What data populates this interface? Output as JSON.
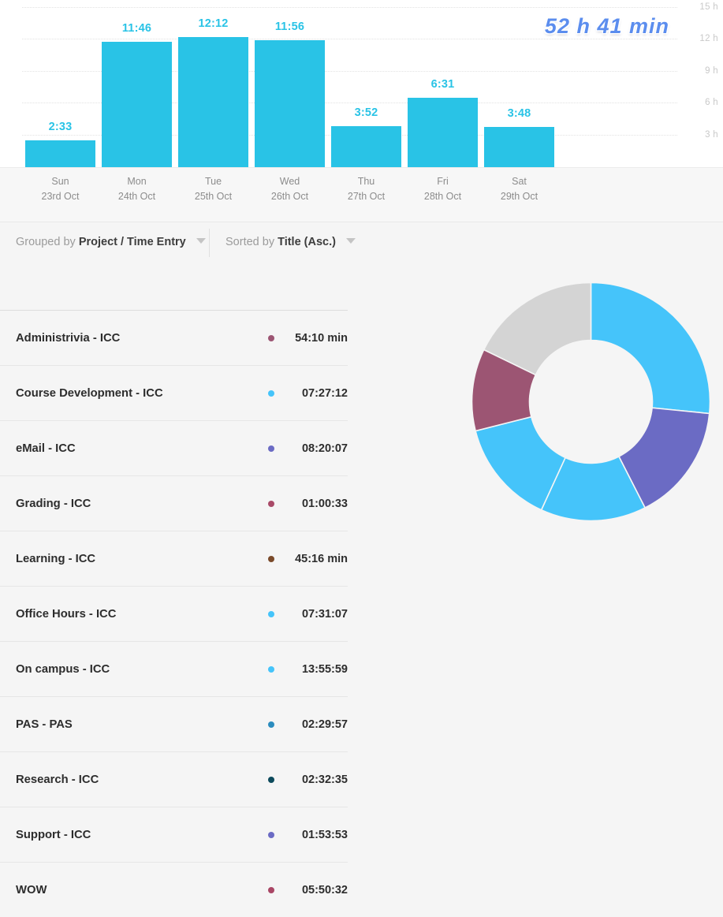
{
  "chart_data": [
    {
      "type": "bar",
      "title": "",
      "xlabel": "",
      "ylabel": "hours",
      "ylim": [
        0,
        15
      ],
      "grid": true,
      "yticks": [
        "3 h",
        "6 h",
        "9 h",
        "12 h",
        "15 h"
      ],
      "ytick_values": [
        3,
        6,
        9,
        12,
        15
      ],
      "categories": [
        "Sun",
        "Mon",
        "Tue",
        "Wed",
        "Thu",
        "Fri",
        "Sat"
      ],
      "dates": [
        "23rd Oct",
        "24th Oct",
        "25th Oct",
        "26th Oct",
        "27th Oct",
        "28th Oct",
        "29th Oct"
      ],
      "labels": [
        "2:33",
        "11:46",
        "12:12",
        "11:56",
        "3:52",
        "6:31",
        "3:48"
      ],
      "values": [
        2.55,
        11.77,
        12.2,
        11.93,
        3.87,
        6.52,
        3.8
      ],
      "total": "52 h 41 min",
      "bar_color": "#29c3e6",
      "label_color": "#29c3e6",
      "total_color": "#5b8dee"
    },
    {
      "type": "pie",
      "title": "",
      "donut": true,
      "legend": "none",
      "labels": [
        "On campus - ICC",
        "eMail - ICC",
        "Office Hours - ICC",
        "Course Development - ICC",
        "WOW",
        "Administrivia - ICC"
      ],
      "values": [
        13.93,
        8.34,
        7.52,
        7.45,
        5.84,
        9.33
      ],
      "colors": [
        "#45c4fa",
        "#6b6bc4",
        "#45c4fa",
        "#45c4fa",
        "#9c5573",
        "#d4d4d4"
      ],
      "start_angle": 0
    }
  ],
  "chart": {
    "total_label": "52 h 41 min",
    "y_ticks": [
      {
        "label": "15 h",
        "value": 15
      },
      {
        "label": "12 h",
        "value": 12
      },
      {
        "label": "9 h",
        "value": 9
      },
      {
        "label": "6 h",
        "value": 6
      },
      {
        "label": "3 h",
        "value": 3
      }
    ],
    "bars": [
      {
        "dow": "Sun",
        "date": "23rd Oct",
        "label": "2:33",
        "value": 2.55
      },
      {
        "dow": "Mon",
        "date": "24th Oct",
        "label": "11:46",
        "value": 11.77
      },
      {
        "dow": "Tue",
        "date": "25th Oct",
        "label": "12:12",
        "value": 12.2
      },
      {
        "dow": "Wed",
        "date": "26th Oct",
        "label": "11:56",
        "value": 11.93
      },
      {
        "dow": "Thu",
        "date": "27th Oct",
        "label": "3:52",
        "value": 3.87
      },
      {
        "dow": "Fri",
        "date": "28th Oct",
        "label": "6:31",
        "value": 6.52
      },
      {
        "dow": "Sat",
        "date": "29th Oct",
        "label": "3:48",
        "value": 3.8
      }
    ]
  },
  "controls": {
    "grouped_by_prefix": "Grouped by",
    "grouped_by_value": "Project / Time Entry",
    "sorted_by_prefix": "Sorted by",
    "sorted_by_value": "Title (Asc.)"
  },
  "entries": [
    {
      "title": "Administrivia - ICC",
      "duration": "54:10 min",
      "color": "#9c5573"
    },
    {
      "title": "Course Development - ICC",
      "duration": "07:27:12",
      "color": "#45c4fa"
    },
    {
      "title": "eMail - ICC",
      "duration": "08:20:07",
      "color": "#6b6bc4"
    },
    {
      "title": "Grading - ICC",
      "duration": "01:00:33",
      "color": "#a94a68"
    },
    {
      "title": "Learning - ICC",
      "duration": "45:16 min",
      "color": "#7a4a2a"
    },
    {
      "title": "Office Hours - ICC",
      "duration": "07:31:07",
      "color": "#45c4fa"
    },
    {
      "title": "On campus - ICC",
      "duration": "13:55:59",
      "color": "#45c4fa"
    },
    {
      "title": "PAS - PAS",
      "duration": "02:29:57",
      "color": "#2b8cbe"
    },
    {
      "title": "Research - ICC",
      "duration": "02:32:35",
      "color": "#0d4a5c"
    },
    {
      "title": "Support - ICC",
      "duration": "01:53:53",
      "color": "#6b6bc4"
    },
    {
      "title": "WOW",
      "duration": "05:50:32",
      "color": "#a94665"
    }
  ],
  "donut": {
    "segments": [
      {
        "name": "On campus - ICC",
        "value": 13.93,
        "color": "#45c4fa"
      },
      {
        "name": "eMail - ICC",
        "value": 8.34,
        "color": "#6b6bc4"
      },
      {
        "name": "Office Hours - ICC",
        "value": 7.52,
        "color": "#45c4fa"
      },
      {
        "name": "Course Development - ICC",
        "value": 7.45,
        "color": "#45c4fa"
      },
      {
        "name": "WOW",
        "value": 5.84,
        "color": "#9c5573"
      },
      {
        "name": "Administrivia - ICC",
        "value": 9.33,
        "color": "#d4d4d4"
      }
    ]
  }
}
